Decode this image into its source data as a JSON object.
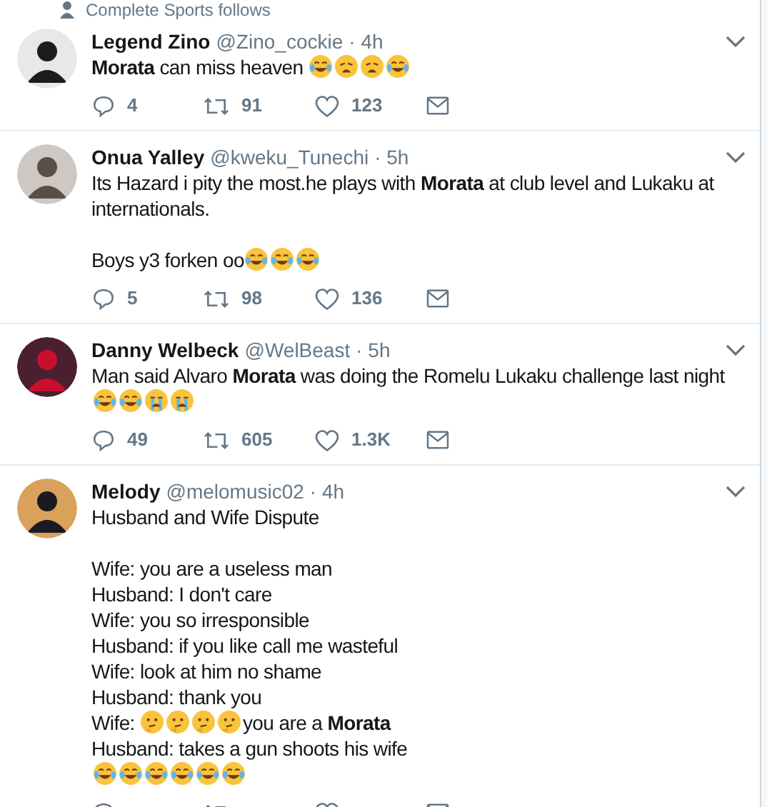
{
  "context": {
    "text": "Complete Sports follows"
  },
  "tweets": [
    {
      "name": "Legend Zino",
      "handle": "@Zino_cockie",
      "time": "· 4h",
      "paragraphs": [
        [
          [
            {
              "kind": "text",
              "text": "**Morata** can miss heaven "
            },
            {
              "kind": "joy"
            },
            {
              "kind": "weary"
            },
            {
              "kind": "weary"
            },
            {
              "kind": "joy"
            }
          ]
        ]
      ],
      "replies": "4",
      "retweets": "91",
      "likes": "123"
    },
    {
      "name": "Onua Yalley",
      "handle": "@kweku_Tunechi",
      "time": "· 5h",
      "paragraphs": [
        [
          [
            {
              "kind": "text",
              "text": "Its Hazard i pity the most.he plays with **Morata** at club level and Lukaku at internationals."
            }
          ]
        ],
        [
          [
            {
              "kind": "text",
              "text": "Boys y3 forken oo"
            },
            {
              "kind": "joy"
            },
            {
              "kind": "joy"
            },
            {
              "kind": "joy"
            }
          ]
        ]
      ],
      "replies": "5",
      "retweets": "98",
      "likes": "136"
    },
    {
      "name": "Danny Welbeck",
      "handle": "@WelBeast",
      "time": "· 5h",
      "paragraphs": [
        [
          [
            {
              "kind": "text",
              "text": "Man said Alvaro **Morata** was doing the Romelu Lukaku challenge last night "
            },
            {
              "kind": "joy"
            },
            {
              "kind": "joy"
            },
            {
              "kind": "sob"
            },
            {
              "kind": "sob"
            }
          ]
        ]
      ],
      "replies": "49",
      "retweets": "605",
      "likes": "1.3K"
    },
    {
      "name": "Melody",
      "handle": "@melomusic02",
      "time": "· 4h",
      "paragraphs": [
        [
          [
            {
              "kind": "text",
              "text": "Husband and Wife Dispute"
            }
          ]
        ],
        [
          [
            {
              "kind": "text",
              "text": "Wife: you are a useless man"
            }
          ],
          [
            {
              "kind": "text",
              "text": "Husband: I don't care"
            }
          ],
          [
            {
              "kind": "text",
              "text": "Wife: you so irresponsible"
            }
          ],
          [
            {
              "kind": "text",
              "text": "Husband: if you like call me wasteful"
            }
          ],
          [
            {
              "kind": "text",
              "text": "Wife: look at him no shame"
            }
          ],
          [
            {
              "kind": "text",
              "text": "Husband: thank you"
            }
          ],
          [
            {
              "kind": "text",
              "text": "Wife: "
            },
            {
              "kind": "thinking"
            },
            {
              "kind": "thinking"
            },
            {
              "kind": "thinking"
            },
            {
              "kind": "thinking"
            },
            {
              "kind": "text",
              "text": "you are a **Morata**"
            }
          ],
          [
            {
              "kind": "text",
              "text": "Husband: takes a gun shoots his wife"
            }
          ],
          [
            {
              "kind": "joy"
            },
            {
              "kind": "joy"
            },
            {
              "kind": "joy"
            },
            {
              "kind": "joy"
            },
            {
              "kind": "joy"
            },
            {
              "kind": "joy"
            }
          ]
        ]
      ]
    }
  ]
}
